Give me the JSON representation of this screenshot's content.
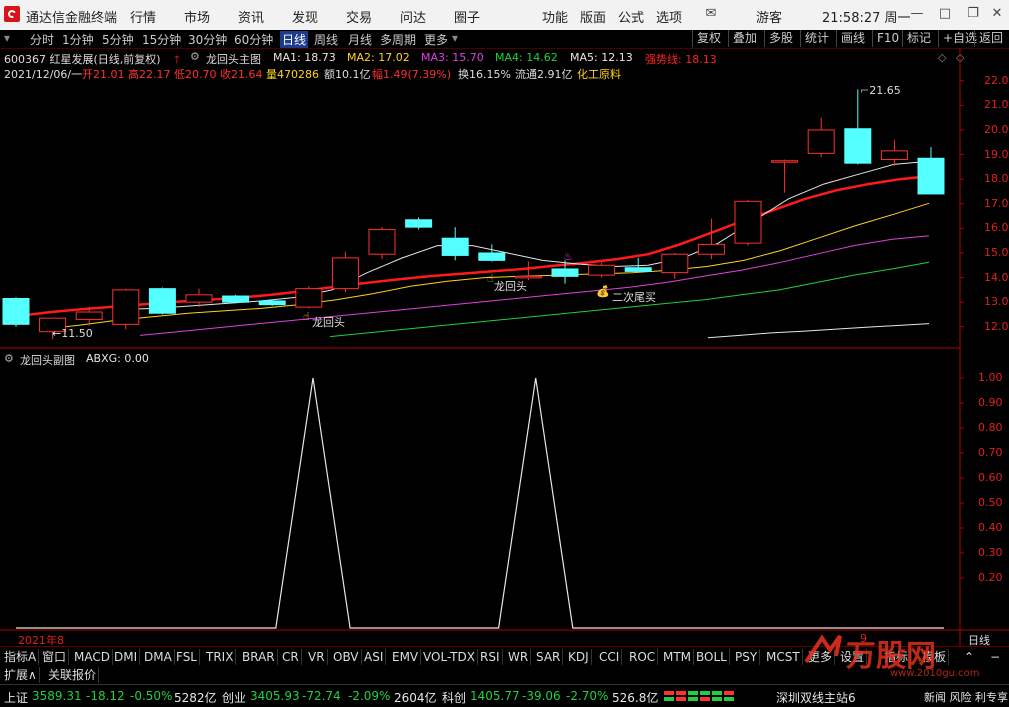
{
  "titlebar": {
    "app_name": "通达信金融终端",
    "menus": [
      "行情",
      "市场",
      "资讯",
      "发现",
      "交易",
      "问达",
      "圈子"
    ],
    "right_menus": [
      "功能",
      "版面",
      "公式",
      "选项"
    ],
    "user": "游客",
    "clock": "21:58:27 周一",
    "colors": {
      "bg": "#f2f2f2",
      "logo": "#d8131b"
    }
  },
  "periods": {
    "items": [
      "分时",
      "1分钟",
      "5分钟",
      "15分钟",
      "30分钟",
      "60分钟",
      "日线",
      "周线",
      "月线",
      "多周期",
      "更多"
    ],
    "active": "日线",
    "right_buttons": [
      "复权",
      "叠加",
      "多股",
      "统计",
      "画线",
      "F10",
      "标记",
      "+自选",
      "返回"
    ]
  },
  "chart_header": {
    "stock": "600367 红星发展(日线,前复权)",
    "main_formula": "龙回头主图",
    "ma": [
      {
        "label": "MA1: 18.73",
        "color": "#e6e6e6"
      },
      {
        "label": "MA2: 17.02",
        "color": "#ffd21e"
      },
      {
        "label": "MA3: 15.70",
        "color": "#e040e0"
      },
      {
        "label": "MA4: 14.62",
        "color": "#20d040"
      },
      {
        "label": "MA5: 12.13",
        "color": "#e6e6e6"
      }
    ],
    "trend_label": "强势线: 18.13"
  },
  "day_info": {
    "date": "2021/12/06/一",
    "open": "开21.01",
    "high": "高22.17",
    "low": "低20.70",
    "close": "收21.64",
    "volume": "量470286",
    "amount": "额10.1亿",
    "change": "幅1.49(7.39%)",
    "turnover": "换16.15%",
    "float_cap": "流通2.91亿",
    "industry": "化工原料"
  },
  "annotations": {
    "high_label": "21.65",
    "low_label": "11.50",
    "signal1": "龙回头",
    "signal2": "龙回头",
    "signal3": "二次尾买"
  },
  "price_axis": [
    "22.00",
    "21.00",
    "20.00",
    "19.00",
    "18.00",
    "17.00",
    "16.00",
    "15.00",
    "14.00",
    "13.00",
    "12.00"
  ],
  "sub_chart": {
    "title": "龙回头副图",
    "value_label": "ABXG: 0.00",
    "axis": [
      "1.00",
      "0.90",
      "0.80",
      "0.70",
      "0.60",
      "0.50",
      "0.40",
      "0.30",
      "0.20"
    ]
  },
  "date_axis": {
    "left": "2021年8",
    "right": "9",
    "period": "日线"
  },
  "indicator_tabs": [
    "指标A",
    "窗口",
    "MACD",
    "DMI",
    "DMA",
    "FSL",
    "TRIX",
    "BRAR",
    "CR",
    "VR",
    "OBV",
    "ASI",
    "EMV",
    "VOL-TDX",
    "RSI",
    "WR",
    "SAR",
    "KDJ",
    "CCI",
    "ROC",
    "MTM",
    "BOLL",
    "PSY",
    "MCST",
    "更多",
    "设置",
    "指标",
    "模板"
  ],
  "sub_tabs": [
    "扩展∧",
    "关联报价"
  ],
  "status": {
    "sh": {
      "name": "上证",
      "price": "3589.31",
      "chg": "-18.12",
      "pct": "-0.50%",
      "amt": "5282亿"
    },
    "cy": {
      "name": "创业",
      "price": "3405.93",
      "chg": "-72.74",
      "pct": "-2.09%",
      "amt": "2604亿"
    },
    "kc": {
      "name": "科创",
      "price": "1405.77",
      "chg": "-39.06",
      "pct": "-2.70%",
      "amt": "526.8亿"
    },
    "server": "深圳双线主站6",
    "news": "新闻 风险 利专享"
  },
  "watermark": "万股网",
  "watermark_url": "www.2010gu.com",
  "chart_data": [
    {
      "type": "candlestick",
      "title": "龙回头主图",
      "ylim": [
        11.3,
        22.6
      ],
      "candles": [
        {
          "o": 13.15,
          "h": 13.2,
          "l": 12.0,
          "c": 12.1
        },
        {
          "o": 11.8,
          "h": 12.35,
          "l": 11.5,
          "c": 12.35
        },
        {
          "o": 12.3,
          "h": 12.8,
          "l": 12.05,
          "c": 12.6
        },
        {
          "o": 12.1,
          "h": 13.55,
          "l": 11.9,
          "c": 13.5
        },
        {
          "o": 13.55,
          "h": 13.6,
          "l": 12.5,
          "c": 12.55
        },
        {
          "o": 13.0,
          "h": 13.55,
          "l": 12.8,
          "c": 13.3
        },
        {
          "o": 13.25,
          "h": 13.3,
          "l": 12.95,
          "c": 13.0
        },
        {
          "o": 13.05,
          "h": 13.1,
          "l": 12.85,
          "c": 12.9
        },
        {
          "o": 12.8,
          "h": 13.65,
          "l": 12.75,
          "c": 13.55
        },
        {
          "o": 13.55,
          "h": 15.05,
          "l": 13.4,
          "c": 14.8
        },
        {
          "o": 14.95,
          "h": 16.05,
          "l": 14.75,
          "c": 15.95
        },
        {
          "o": 16.35,
          "h": 16.45,
          "l": 15.95,
          "c": 16.05
        },
        {
          "o": 15.6,
          "h": 16.05,
          "l": 14.7,
          "c": 14.9
        },
        {
          "o": 15.0,
          "h": 15.35,
          "l": 14.65,
          "c": 14.7
        },
        {
          "o": 14.0,
          "h": 14.65,
          "l": 13.9,
          "c": 14.05
        },
        {
          "o": 14.35,
          "h": 14.7,
          "l": 13.75,
          "c": 14.05
        },
        {
          "o": 14.1,
          "h": 14.6,
          "l": 14.0,
          "c": 14.5
        },
        {
          "o": 14.4,
          "h": 14.8,
          "l": 14.25,
          "c": 14.25
        },
        {
          "o": 14.2,
          "h": 15.0,
          "l": 13.95,
          "c": 14.95
        },
        {
          "o": 14.95,
          "h": 16.4,
          "l": 14.75,
          "c": 15.35
        },
        {
          "o": 15.4,
          "h": 17.15,
          "l": 15.3,
          "c": 17.1
        },
        {
          "o": 18.75,
          "h": 18.8,
          "l": 17.45,
          "c": 18.75
        },
        {
          "o": 19.05,
          "h": 20.5,
          "l": 18.9,
          "c": 20.0
        },
        {
          "o": 20.05,
          "h": 21.65,
          "l": 18.6,
          "c": 18.65
        },
        {
          "o": 18.8,
          "h": 19.6,
          "l": 18.55,
          "c": 19.15
        },
        {
          "o": 18.85,
          "h": 19.3,
          "l": 17.4,
          "c": 17.4
        }
      ],
      "series": [
        {
          "name": "强势线",
          "color": "#ff1a1a",
          "values": [
            12.45,
            12.6,
            12.72,
            12.82,
            12.92,
            13.02,
            13.1,
            13.18,
            13.3,
            13.45,
            13.62,
            13.78,
            13.92,
            14.05,
            14.15,
            14.25,
            14.35,
            14.48,
            14.6,
            14.75,
            14.95,
            15.35,
            15.82,
            16.3,
            16.75,
            17.2,
            17.55,
            17.8,
            18.0,
            18.13
          ]
        },
        {
          "name": "MA1",
          "color": "#e6e6e6",
          "values": [
            null,
            null,
            null,
            12.7,
            12.75,
            12.85,
            12.95,
            13.05,
            13.2,
            13.5,
            14.2,
            14.8,
            15.3,
            15.3,
            15.0,
            14.7,
            14.55,
            14.45,
            14.5,
            14.8,
            15.4,
            16.3,
            17.2,
            17.8,
            18.2,
            18.6,
            18.73
          ]
        },
        {
          "name": "MA2",
          "color": "#ffd21e",
          "values": [
            11.9,
            12.05,
            12.25,
            12.4,
            12.55,
            12.65,
            12.75,
            12.9,
            13.1,
            13.35,
            13.65,
            13.85,
            14.0,
            14.05,
            14.1,
            14.15,
            14.2,
            14.3,
            14.45,
            14.7,
            15.1,
            15.6,
            16.1,
            16.55,
            17.02
          ]
        },
        {
          "name": "MA3",
          "color": "#e040e0",
          "values": [
            11.65,
            11.8,
            11.95,
            12.1,
            12.25,
            12.4,
            12.55,
            12.7,
            12.85,
            13.0,
            13.15,
            13.3,
            13.45,
            13.6,
            13.8,
            14.05,
            14.3,
            14.6,
            14.95,
            15.3,
            15.55,
            15.7
          ]
        },
        {
          "name": "MA4",
          "color": "#20d040",
          "values": [
            11.6,
            11.75,
            11.9,
            12.05,
            12.2,
            12.35,
            12.5,
            12.65,
            12.8,
            12.95,
            13.1,
            13.3,
            13.5,
            13.8,
            14.1,
            14.35,
            14.62
          ]
        },
        {
          "name": "MA5",
          "color": "#e6e6e6",
          "values": [
            11.55,
            11.65,
            11.75,
            11.82,
            11.9,
            11.98,
            12.05,
            12.13
          ]
        }
      ]
    },
    {
      "type": "line",
      "title": "龙回头副图",
      "series_name": "ABXG",
      "ylim": [
        0,
        1.0
      ],
      "values": [
        0,
        0,
        0,
        0,
        0,
        0,
        0,
        0,
        1,
        0,
        0,
        0,
        0,
        0,
        1,
        0,
        0,
        0,
        0,
        0,
        0,
        0,
        0,
        0,
        0,
        0
      ]
    }
  ]
}
